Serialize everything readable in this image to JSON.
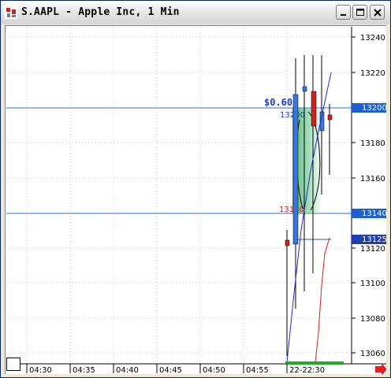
{
  "window": {
    "title": "S.AAPL - Apple Inc, 1 Min",
    "controls": [
      {
        "name": "minimize-button",
        "icon": "minimize-icon"
      },
      {
        "name": "maximize-button",
        "icon": "maximize-icon"
      },
      {
        "name": "close-button",
        "icon": "close-icon"
      }
    ]
  },
  "chart": {
    "price_axis_ticks": [
      "13240",
      "13220",
      "13200",
      "13180",
      "13160",
      "13140",
      "13120",
      "13100",
      "13080",
      "13060"
    ],
    "time_axis_labels": [
      "04:30",
      "04:35",
      "04:40",
      "04:45",
      "04:50",
      "04:55",
      "22-22:30"
    ],
    "line_labels": {
      "upper_tag": "13200",
      "lower_tag": "13140",
      "current_tag": "13125"
    },
    "annotations": {
      "profit": "$0.60",
      "entry": "13200",
      "stop": "13140"
    },
    "colors": {
      "horizontal_line": "#2a6fd6",
      "tag_bg": "#1e5fd0",
      "up_candle": "#3a78d8",
      "down_candle": "#cc2222",
      "zone_fill": "#5cb87e",
      "accent_arrow": "#e02020"
    },
    "scroll_arrow_icon": "red-right-arrow-icon"
  }
}
